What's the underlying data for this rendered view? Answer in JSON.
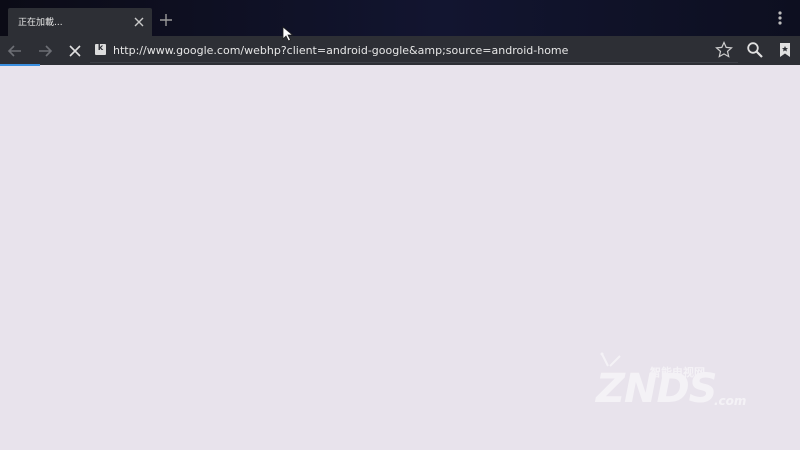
{
  "tab": {
    "title": "正在加載..."
  },
  "address_bar": {
    "url": "http://www.google.com/webhp?client=android-google&amp;source=android-home"
  },
  "page_load_progress": 0.05,
  "watermark": {
    "brand": "ZNDS",
    "chinese": "智能电视网",
    "suffix": ".com"
  },
  "icons": [
    "close-icon",
    "plus-icon",
    "more-vert-icon",
    "back-arrow-icon",
    "forward-arrow-icon",
    "stop-icon",
    "site-icon",
    "star-icon",
    "search-icon",
    "bookmark-icon",
    "mouse-cursor-icon"
  ],
  "colors": {
    "tabbar_bg": "#0b0b16",
    "toolbar_bg": "#2d2f35",
    "page_bg": "#e8e3ec",
    "progress": "#3a8fe0"
  }
}
